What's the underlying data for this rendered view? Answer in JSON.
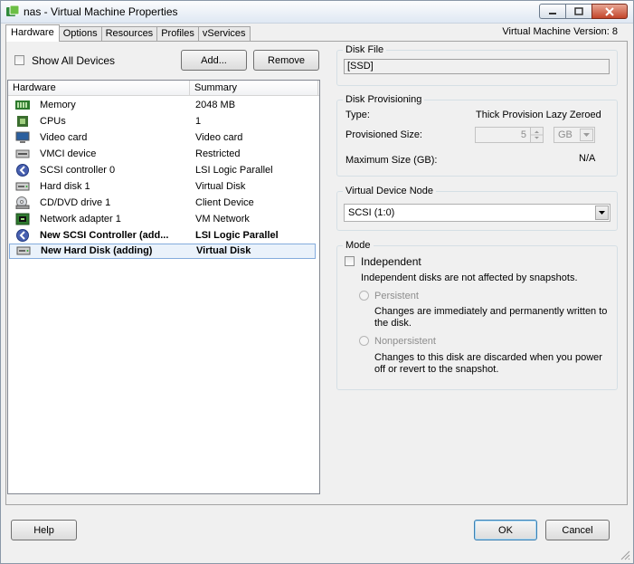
{
  "window": {
    "title": "nas - Virtual Machine Properties"
  },
  "tabs": [
    "Hardware",
    "Options",
    "Resources",
    "Profiles",
    "vServices"
  ],
  "vm_version": "Virtual Machine Version: 8",
  "hardware_panel": {
    "show_all_devices": "Show All Devices",
    "add_button": "Add...",
    "remove_button": "Remove",
    "columns": {
      "hardware": "Hardware",
      "summary": "Summary"
    },
    "rows": [
      {
        "name": "Memory",
        "summary": "2048 MB",
        "icon": "memory-icon",
        "bold": false
      },
      {
        "name": "CPUs",
        "summary": "1",
        "icon": "cpu-icon",
        "bold": false
      },
      {
        "name": "Video card",
        "summary": "Video card",
        "icon": "video-card-icon",
        "bold": false
      },
      {
        "name": "VMCI device",
        "summary": "Restricted",
        "icon": "vmci-device-icon",
        "bold": false
      },
      {
        "name": "SCSI controller 0",
        "summary": "LSI Logic Parallel",
        "icon": "scsi-controller-icon",
        "bold": false
      },
      {
        "name": "Hard disk 1",
        "summary": "Virtual Disk",
        "icon": "hard-disk-icon",
        "bold": false
      },
      {
        "name": "CD/DVD drive 1",
        "summary": "Client Device",
        "icon": "cd-dvd-drive-icon",
        "bold": false
      },
      {
        "name": "Network adapter 1",
        "summary": "VM Network",
        "icon": "network-adapter-icon",
        "bold": false
      },
      {
        "name": "New SCSI Controller (add...",
        "summary": "LSI Logic Parallel",
        "icon": "scsi-controller-icon",
        "bold": true
      },
      {
        "name": "New Hard Disk (adding)",
        "summary": "Virtual Disk",
        "icon": "hard-disk-icon",
        "bold": true
      }
    ]
  },
  "disk_file": {
    "label": "Disk File",
    "value": "[SSD]"
  },
  "disk_provisioning": {
    "label": "Disk Provisioning",
    "type_label": "Type:",
    "type_value": "Thick Provision Lazy Zeroed",
    "size_label": "Provisioned Size:",
    "size_value": "5",
    "size_unit": "GB",
    "max_label": "Maximum Size (GB):",
    "max_value": "N/A"
  },
  "virtual_device_node": {
    "label": "Virtual Device Node",
    "value": "SCSI (1:0)"
  },
  "mode": {
    "label": "Mode",
    "independent": "Independent",
    "independent_desc": "Independent disks are not affected by snapshots.",
    "persistent": "Persistent",
    "persistent_desc": [
      "Changes are immediately and permanently written to",
      "the disk."
    ],
    "nonpersistent": "Nonpersistent",
    "nonpersistent_desc": [
      "Changes to this disk are discarded when you power",
      "off or revert to the snapshot."
    ]
  },
  "footer": {
    "help": "Help",
    "ok": "OK",
    "cancel": "Cancel"
  }
}
